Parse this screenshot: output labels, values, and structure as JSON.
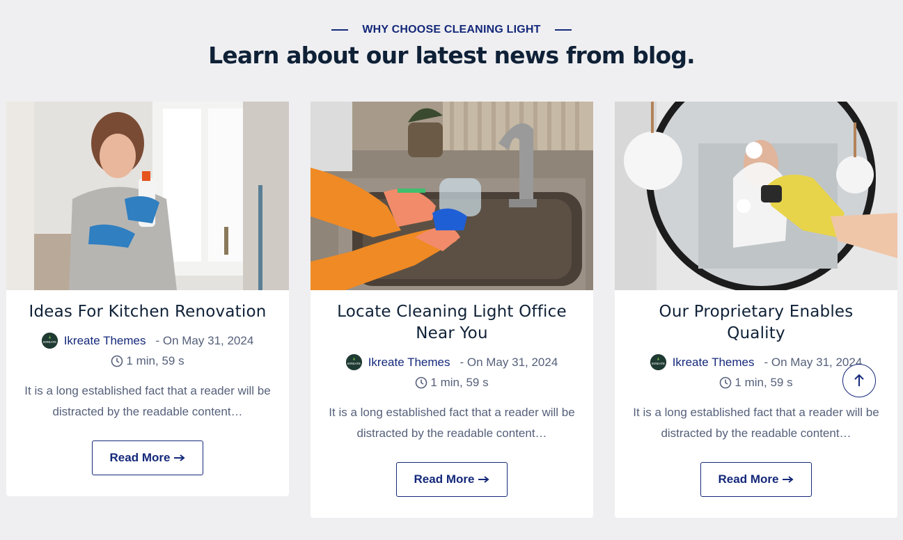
{
  "section": {
    "eyebrow": "WHY CHOOSE CLEANING LIGHT",
    "headline": "Learn about our latest news from blog."
  },
  "posts": [
    {
      "title": "Ideas For Kitchen Renovation",
      "author": "Ikreate Themes",
      "date": "- On May 31, 2024",
      "read_time": "1 min, 59 s",
      "excerpt": "It is a long established fact that a reader will be distracted by the readable content…",
      "button": "Read More",
      "image": "woman-holding-cleaning-bottle-photo"
    },
    {
      "title": "Locate Cleaning Light Office Near You",
      "author": "Ikreate Themes",
      "date": "- On May 31, 2024",
      "read_time": "1 min, 59 s",
      "excerpt": "It is a long established fact that a reader will be distracted by the readable content…",
      "button": "Read More",
      "image": "washing-glass-at-kitchen-sink-photo"
    },
    {
      "title": "Our Proprietary Enables Quality",
      "author": "Ikreate Themes",
      "date": "- On May 31, 2024",
      "read_time": "1 min, 59 s",
      "excerpt": "It is a long established fact that a reader will be distracted by the readable content…",
      "button": "Read More",
      "image": "cleaning-round-mirror-photo"
    }
  ],
  "avatar_label": "IKREATE",
  "icons": {
    "clock": "clock-icon",
    "arrow": "arrow-right-icon",
    "scroll": "arrow-up-icon"
  },
  "colors": {
    "accent": "#14287a",
    "heading": "#0f2137",
    "text": "#55607a",
    "background": "#efeff1"
  }
}
